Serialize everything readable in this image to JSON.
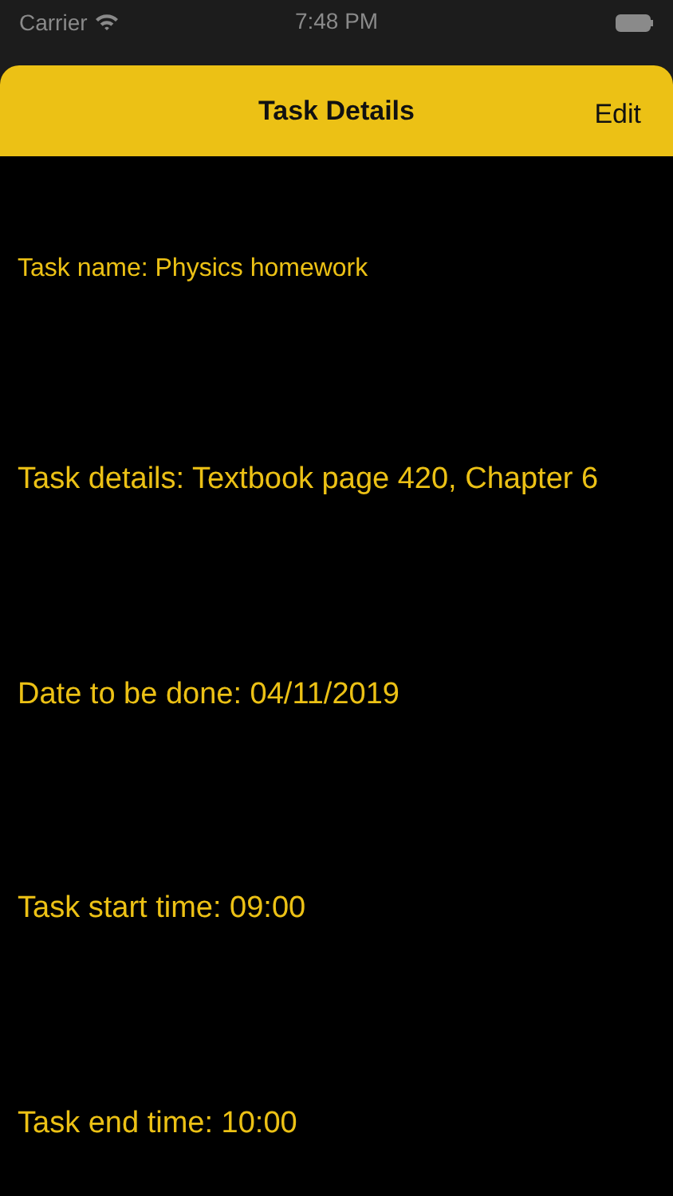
{
  "status_bar": {
    "carrier": "Carrier",
    "time": "7:48 PM"
  },
  "sheet": {
    "title": "Task Details",
    "edit": "Edit"
  },
  "fields": [
    {
      "kind": "small",
      "text": "Task name: Physics homework"
    },
    {
      "kind": "large",
      "text": "Task details: Textbook page 420, Chapter 6"
    },
    {
      "kind": "large",
      "text": "Date to be done: 04/11/2019"
    },
    {
      "kind": "large",
      "text": "Task start time: 09:00"
    },
    {
      "kind": "large",
      "text": "Task end time: 10:00"
    }
  ]
}
